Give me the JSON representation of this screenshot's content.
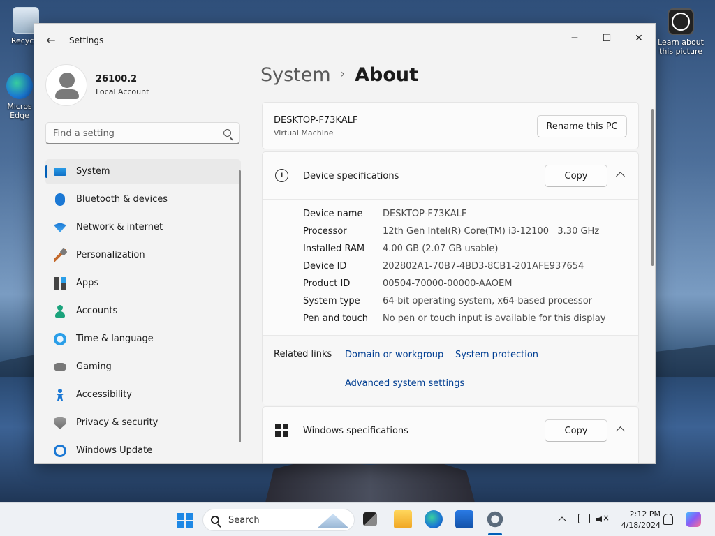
{
  "desktop": {
    "icons": [
      {
        "label": "Recycle"
      },
      {
        "label": "Micros Edge"
      },
      {
        "label": "Learn about this picture"
      }
    ]
  },
  "window": {
    "title": "Settings",
    "controls": {
      "minimize": "─",
      "maximize": "☐",
      "close": "✕"
    }
  },
  "profile": {
    "name": "26100.2",
    "account": "Local Account"
  },
  "search": {
    "placeholder": "Find a setting"
  },
  "sidebar": {
    "items": [
      {
        "label": "System",
        "icon": "monitor-icon",
        "active": true
      },
      {
        "label": "Bluetooth & devices",
        "icon": "bluetooth-icon"
      },
      {
        "label": "Network & internet",
        "icon": "wifi-icon"
      },
      {
        "label": "Personalization",
        "icon": "brush-icon"
      },
      {
        "label": "Apps",
        "icon": "apps-icon"
      },
      {
        "label": "Accounts",
        "icon": "person-icon"
      },
      {
        "label": "Time & language",
        "icon": "clock-globe-icon"
      },
      {
        "label": "Gaming",
        "icon": "gamepad-icon"
      },
      {
        "label": "Accessibility",
        "icon": "accessibility-icon"
      },
      {
        "label": "Privacy & security",
        "icon": "shield-icon"
      },
      {
        "label": "Windows Update",
        "icon": "update-icon"
      }
    ]
  },
  "breadcrumb": {
    "parent": "System",
    "separator": "›",
    "current": "About"
  },
  "pc": {
    "name": "DESKTOP-F73KALF",
    "type": "Virtual Machine",
    "rename_label": "Rename this PC"
  },
  "device_specs": {
    "title": "Device specifications",
    "copy_label": "Copy",
    "rows": [
      {
        "label": "Device name",
        "value": "DESKTOP-F73KALF"
      },
      {
        "label": "Processor",
        "value": "12th Gen Intel(R) Core(TM) i3-12100   3.30 GHz"
      },
      {
        "label": "Installed RAM",
        "value": "4.00 GB (2.07 GB usable)"
      },
      {
        "label": "Device ID",
        "value": "202802A1-70B7-4BD3-8CB1-201AFE937654"
      },
      {
        "label": "Product ID",
        "value": "00504-70000-00000-AAOEM"
      },
      {
        "label": "System type",
        "value": "64-bit operating system, x64-based processor"
      },
      {
        "label": "Pen and touch",
        "value": "No pen or touch input is available for this display"
      }
    ]
  },
  "related_links": {
    "label": "Related links",
    "links": [
      "Domain or workgroup",
      "System protection",
      "Advanced system settings"
    ]
  },
  "windows_specs": {
    "title": "Windows specifications",
    "copy_label": "Copy"
  },
  "taskbar": {
    "search_label": "Search",
    "time": "2:12 PM",
    "date": "4/18/2024"
  }
}
